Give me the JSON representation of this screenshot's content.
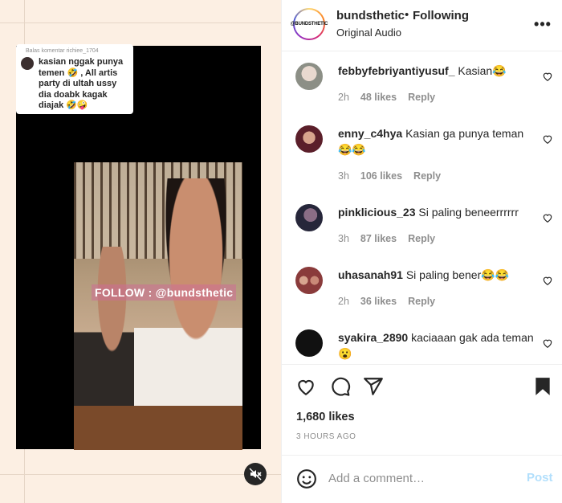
{
  "reply_card": {
    "header": "Balas komentar richiee_1704",
    "text": "kasian nggak punya temen 🤣 , All artis party di ultah ussy dia doabk kagak diajak 🤣🤪"
  },
  "watermark": "FOLLOW : @bundsthetic",
  "post": {
    "avatar_text": "@BUNDSTHETIC",
    "username": "bundsthetic",
    "separator": "•",
    "follow_status": "Following",
    "audio": "Original Audio",
    "more": "•••"
  },
  "comments": [
    {
      "user": "febbyfebriyantiyusuf_",
      "text": "Kasian😂",
      "time": "2h",
      "likes": "48 likes",
      "reply": "Reply"
    },
    {
      "user": "enny_c4hya",
      "text": "Kasian ga punya teman 😂😂",
      "time": "3h",
      "likes": "106 likes",
      "reply": "Reply"
    },
    {
      "user": "pinklicious_23",
      "text": "Si paling beneerrrrrr",
      "time": "3h",
      "likes": "87 likes",
      "reply": "Reply"
    },
    {
      "user": "uhasanah91",
      "text": "Si paling bener😂😂",
      "time": "2h",
      "likes": "36 likes",
      "reply": "Reply"
    },
    {
      "user": "syakira_2890",
      "text": "kaciaaan gak ada teman 😮",
      "time": "",
      "likes": "",
      "reply": ""
    }
  ],
  "like_count": "1,680 likes",
  "post_time": "3 HOURS AGO",
  "add_comment": {
    "placeholder": "Add a comment…",
    "post_label": "Post"
  },
  "colors": {
    "link_blue_disabled": "#b2dffc",
    "text": "#262626",
    "muted": "#8e8e8e"
  }
}
